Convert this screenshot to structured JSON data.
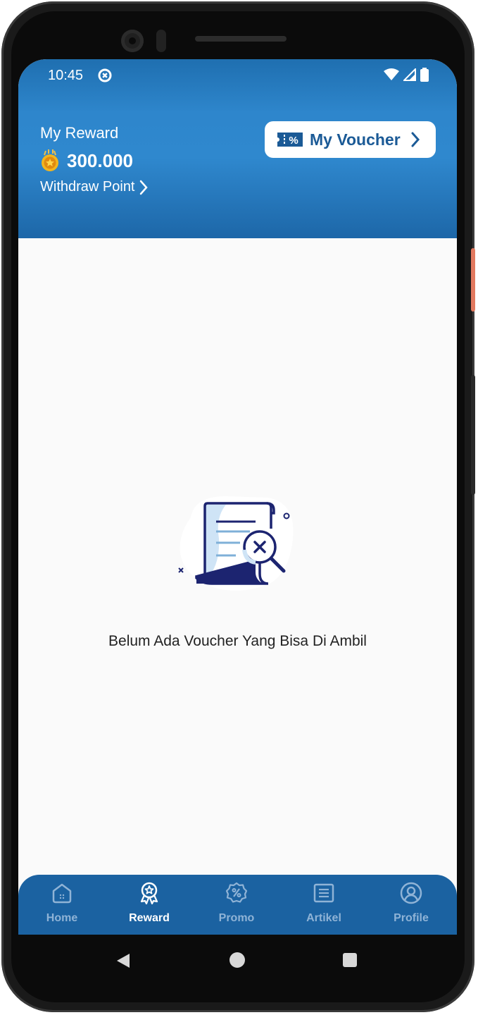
{
  "status_bar": {
    "time": "10:45",
    "icons": [
      "app-notification-icon",
      "wifi-icon",
      "signal-icon",
      "battery-icon"
    ]
  },
  "header": {
    "title": "My Reward",
    "points": "300.000",
    "withdraw_label": "Withdraw Point",
    "voucher_button_label": "My Voucher"
  },
  "empty_state": {
    "message": "Belum Ada Voucher Yang Bisa Di Ambil"
  },
  "bottom_nav": {
    "items": [
      {
        "label": "Home",
        "icon": "home-icon",
        "active": false
      },
      {
        "label": "Reward",
        "icon": "reward-badge-icon",
        "active": true
      },
      {
        "label": "Promo",
        "icon": "promo-percent-icon",
        "active": false
      },
      {
        "label": "Artikel",
        "icon": "article-icon",
        "active": false
      },
      {
        "label": "Profile",
        "icon": "profile-icon",
        "active": false
      }
    ]
  },
  "colors": {
    "header_blue": "#2e86cc",
    "nav_blue": "#1b62a1",
    "voucher_text": "#1b5a96",
    "inactive_nav": "#8fb3d6",
    "illustration_navy": "#1c2470",
    "illustration_light": "#cfe4f6"
  }
}
